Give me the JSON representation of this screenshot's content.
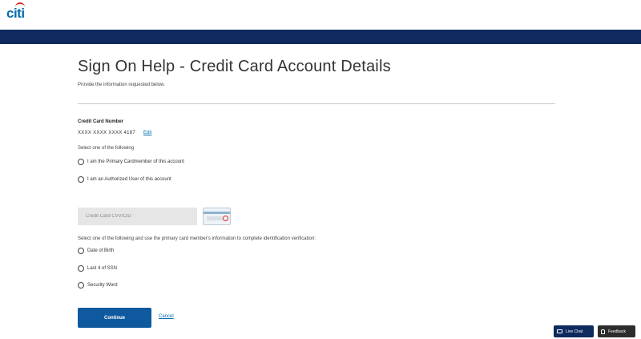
{
  "header": {
    "logo": "citi"
  },
  "page": {
    "title": "Sign On Help - Credit Card Account Details",
    "subtitle": "Provide the information requested below."
  },
  "card": {
    "label": "Credit Card Number",
    "masked_number": "XXXX XXXX XXXX 4187",
    "edit_label": "Edit"
  },
  "role": {
    "prompt": "Select one of the following",
    "options": [
      "I am the Primary Cardmember of this account",
      "I am an Authorized User of this account"
    ]
  },
  "cvv": {
    "placeholder": "Credit Card CVV/CID",
    "value": ""
  },
  "verification": {
    "prompt": "Select one of the following and use the primary card member's information to complete identification verification:",
    "options": [
      "Date of Birth",
      "Last 4 of SSN",
      "Security Word"
    ]
  },
  "actions": {
    "continue_label": "Continue",
    "cancel_label": "Cancel"
  },
  "floating": {
    "live_chat_label": "Live Chat",
    "feedback_label": "Feedback"
  },
  "colors": {
    "brand_blue": "#056dae",
    "band_navy": "#0f2a5e",
    "button_blue": "#0f5a9e",
    "logo_arc_red": "#d9261c"
  }
}
